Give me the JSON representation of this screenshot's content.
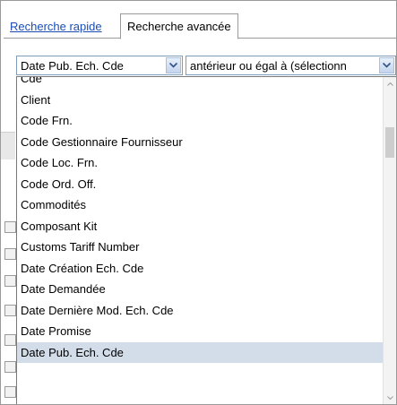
{
  "tabs": {
    "quick": "Recherche rapide",
    "advanced": "Recherche avancée"
  },
  "field_select": {
    "value": "Date Pub. Ech. Cde"
  },
  "operator_select": {
    "value": "antérieur ou égal à (sélectionn"
  },
  "dropdown": {
    "items": [
      "Cde",
      "Client",
      "Code Frn.",
      "Code Gestionnaire Fournisseur",
      "Code Loc. Frn.",
      "Code Ord. Off.",
      "Commodités",
      "Composant Kit",
      "Customs Tariff Number",
      "Date Création Ech. Cde",
      "Date Demandée",
      "Date Dernière Mod. Ech. Cde",
      "Date Promise",
      "Date Pub. Ech. Cde"
    ],
    "selected": "Date Pub. Ech. Cde"
  },
  "icons": {
    "dropdown_arrow": "chevron-down-icon",
    "scroll_up": "scroll-up-icon",
    "scroll_down": "scroll-down-icon"
  },
  "colors": {
    "link": "#1a4db3",
    "selection": "#d3dde9",
    "border": "#7f9db9"
  }
}
